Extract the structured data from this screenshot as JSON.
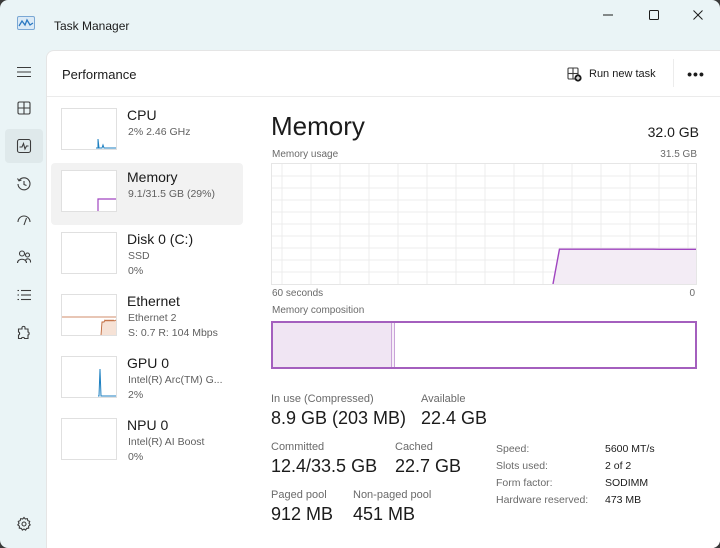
{
  "window": {
    "app_icon": "task-manager-icon",
    "title": "Task Manager",
    "controls": {
      "minimize": "minimize-icon",
      "maximize": "maximize-icon",
      "close": "close-icon"
    }
  },
  "nav": {
    "menu_icon": "hamburger-menu-icon",
    "items": [
      {
        "name": "Processes",
        "icon": "processes-icon",
        "active": false
      },
      {
        "name": "Performance",
        "icon": "performance-icon",
        "active": true
      },
      {
        "name": "App history",
        "icon": "history-icon",
        "active": false
      },
      {
        "name": "Startup apps",
        "icon": "speedometer-icon",
        "active": false
      },
      {
        "name": "Users",
        "icon": "users-icon",
        "active": false
      },
      {
        "name": "Details",
        "icon": "list-icon",
        "active": false
      },
      {
        "name": "Services",
        "icon": "puzzle-icon",
        "active": false
      }
    ],
    "settings_icon": "gear-icon"
  },
  "header": {
    "page_title": "Performance",
    "run_new_task_label": "Run new task",
    "more_label": "•••"
  },
  "sidebar": {
    "items": [
      {
        "title": "CPU",
        "sub1": "2% 2.46 GHz",
        "sub2": "",
        "selected": false,
        "color": "#1c7fc0"
      },
      {
        "title": "Memory",
        "sub1": "9.1/31.5 GB (29%)",
        "sub2": "",
        "selected": true,
        "color": "#a045c0"
      },
      {
        "title": "Disk 0 (C:)",
        "sub1": "SSD",
        "sub2": "0%",
        "selected": false,
        "color": "#4c9a2a"
      },
      {
        "title": "Ethernet",
        "sub1": "Ethernet 2",
        "sub2": "S: 0.7 R: 104 Mbps",
        "selected": false,
        "color": "#c0683a"
      },
      {
        "title": "GPU 0",
        "sub1": "Intel(R) Arc(TM) G...",
        "sub2": "2%",
        "selected": false,
        "color": "#1c7fc0"
      },
      {
        "title": "NPU 0",
        "sub1": "Intel(R) AI Boost",
        "sub2": "0%",
        "selected": false,
        "color": "#1c7fc0"
      }
    ]
  },
  "main": {
    "title": "Memory",
    "total": "32.0 GB",
    "usage_label": "Memory usage",
    "usage_max": "31.5 GB",
    "axis_left": "60 seconds",
    "axis_right": "0",
    "composition_label": "Memory composition",
    "accent_color": "#a045c0",
    "usage_history_fraction": [
      0,
      0,
      0,
      0,
      0,
      0,
      0,
      0,
      0,
      0,
      0,
      0,
      0,
      0,
      0,
      0,
      0,
      0,
      0,
      0,
      0,
      0,
      0,
      0,
      0,
      0,
      0,
      0,
      0,
      0,
      0,
      0,
      0,
      0,
      0,
      0,
      0,
      0,
      0,
      0,
      0.29,
      0.29,
      0.29,
      0.29,
      0.29,
      0.29,
      0.29,
      0.29,
      0.29,
      0.29,
      0.29,
      0.29,
      0.29,
      0.29,
      0.289,
      0.289,
      0.289,
      0.289,
      0.289,
      0.289
    ],
    "composition": {
      "in_use_fraction": 0.283,
      "modified_fraction": 0.006
    },
    "stats": {
      "in_use_label": "In use (Compressed)",
      "in_use_value": "8.9 GB (203 MB)",
      "available_label": "Available",
      "available_value": "22.4 GB",
      "committed_label": "Committed",
      "committed_value": "12.4/33.5 GB",
      "cached_label": "Cached",
      "cached_value": "22.7 GB",
      "paged_pool_label": "Paged pool",
      "paged_pool_value": "912 MB",
      "nonpaged_pool_label": "Non-paged pool",
      "nonpaged_pool_value": "451 MB"
    },
    "specs": [
      {
        "key": "Speed:",
        "value": "5600 MT/s"
      },
      {
        "key": "Slots used:",
        "value": "2 of 2"
      },
      {
        "key": "Form factor:",
        "value": "SODIMM"
      },
      {
        "key": "Hardware reserved:",
        "value": "473 MB"
      }
    ]
  }
}
